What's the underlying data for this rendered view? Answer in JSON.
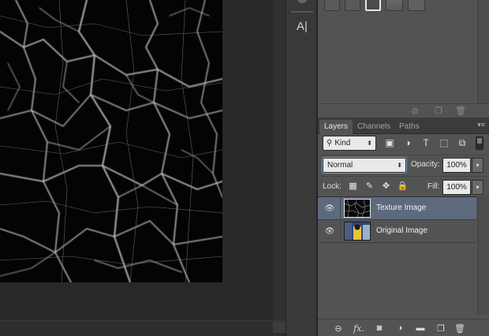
{
  "tool_dock": {
    "char_tool_glyph": "A|"
  },
  "layers_panel": {
    "tabs": [
      {
        "label": "Layers",
        "active": true
      },
      {
        "label": "Channels",
        "active": false
      },
      {
        "label": "Paths",
        "active": false
      }
    ],
    "filter": {
      "kind_label": "Kind",
      "search_glyph": "⚲",
      "arrows": "⬍"
    },
    "blend_mode": {
      "value": "Normal",
      "arrows": "⬍"
    },
    "opacity": {
      "label": "Opacity:",
      "value": "100%",
      "button": "▾"
    },
    "lock": {
      "label": "Lock:"
    },
    "fill": {
      "label": "Fill:",
      "value": "100%",
      "button": "▾"
    },
    "layers": [
      {
        "name": "Texture Image",
        "selected": true,
        "visible": true,
        "eye": "👁"
      },
      {
        "name": "Original Image",
        "selected": false,
        "visible": true,
        "eye": "👁"
      }
    ],
    "footer_icons": [
      "link-icon",
      "fx-icon",
      "mask-icon",
      "adjustment-icon",
      "group-icon",
      "new-layer-icon",
      "trash-icon"
    ],
    "footer_glyphs": {
      "link": "⊖",
      "fx": "fx.",
      "mask": "◙",
      "adjust": "◑",
      "group": "▬",
      "new": "❐",
      "trash": "🗑"
    }
  },
  "swatch_panel": {
    "footer_glyphs": {
      "delete_state": "⊘",
      "new_item": "❐",
      "trash": "🗑"
    }
  },
  "colors": {
    "panel_bg": "#535353",
    "selection": "#5d6a7e",
    "workspace": "#282828",
    "canvas": "#050505"
  }
}
